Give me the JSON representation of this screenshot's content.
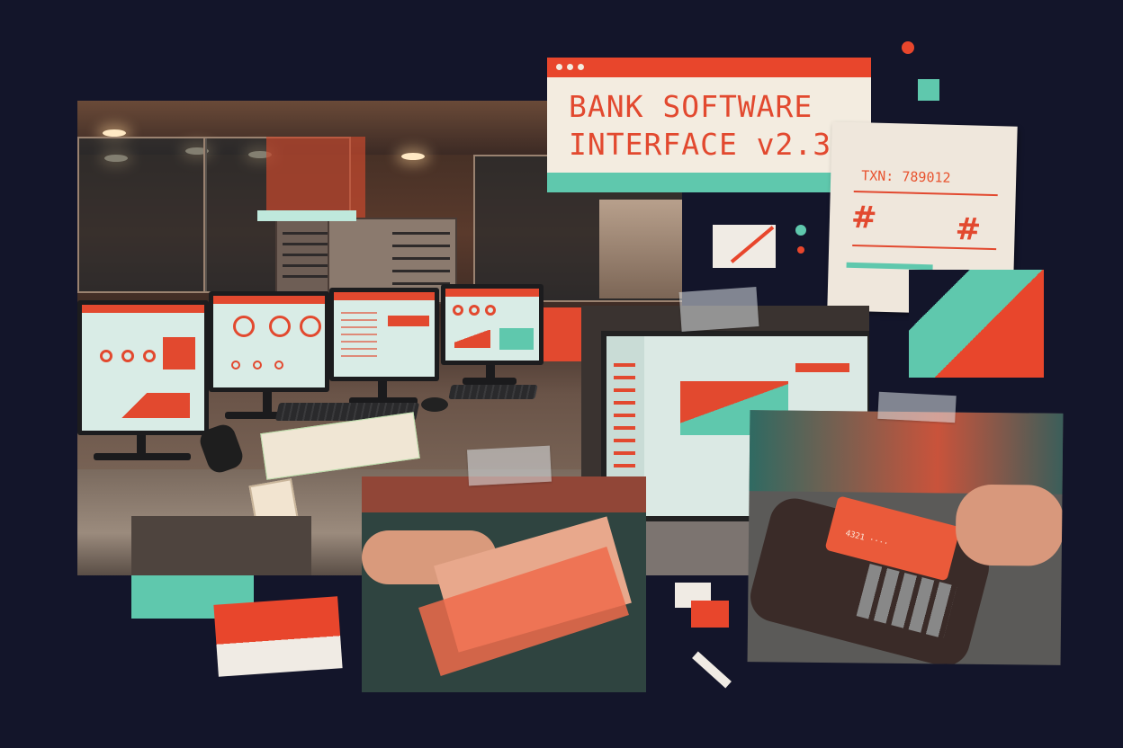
{
  "title_window": {
    "line1": "BANK SOFTWARE",
    "line2": "INTERFACE v2.3"
  },
  "receipt": {
    "txn": "TXN: 789012",
    "hash_left": "#",
    "hash_right": "#"
  },
  "colors": {
    "background": "#13152a",
    "accent_orange": "#e8462c",
    "accent_teal": "#5fc8ad",
    "paper": "#f3ece0"
  },
  "icons": [
    "window-dots-icon",
    "hash-icon"
  ]
}
